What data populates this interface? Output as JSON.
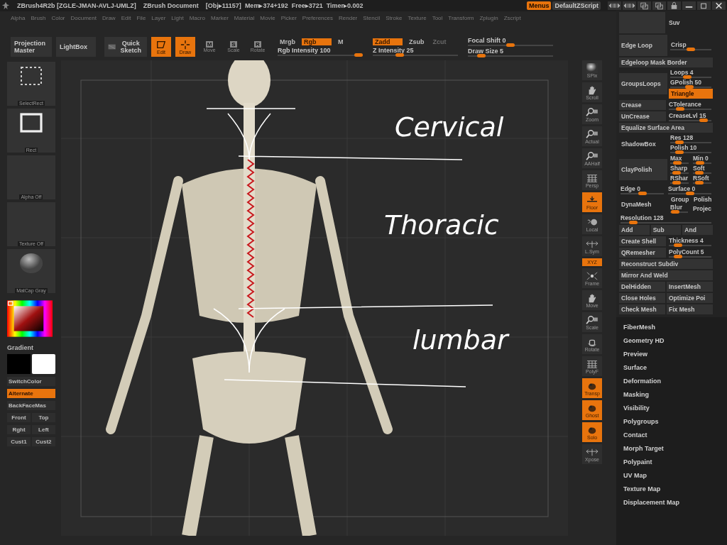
{
  "title_bar": {
    "app": "ZBrush4R2b [ZGLE-JMAN-AVLJ-UMLZ]",
    "document": "ZBrush Document",
    "stats": [
      "[Obj▸11157]",
      "Mem▸374+192",
      "Free▸3721",
      "Timer▸0.002"
    ],
    "buttons": [
      {
        "label": "Menus",
        "selected": true
      },
      {
        "label": "DefaultZScript",
        "selected": false
      }
    ]
  },
  "menu_bar": [
    "Alpha",
    "Brush",
    "Color",
    "Document",
    "Draw",
    "Edit",
    "File",
    "Layer",
    "Light",
    "Macro",
    "Marker",
    "Material",
    "Movie",
    "Picker",
    "Preferences",
    "Render",
    "Stencil",
    "Stroke",
    "Texture",
    "Tool",
    "Transform",
    "Zplugin",
    "Zscript"
  ],
  "toolbar": {
    "buttons": [
      "Projection Master",
      "LightBox",
      "Quick Sketch"
    ],
    "modes": [
      {
        "label": "Edit",
        "on": true
      },
      {
        "label": "Draw",
        "on": true
      },
      {
        "label": "Move",
        "key": "M",
        "on": false
      },
      {
        "label": "Scale",
        "key": "S",
        "on": false
      },
      {
        "label": "Rotate",
        "key": "R",
        "on": false
      }
    ],
    "color_toggles": [
      {
        "label": "Mrgb",
        "on": false
      },
      {
        "label": "Rgb",
        "on": true
      },
      {
        "label": "M",
        "on": false
      }
    ],
    "rgb_intensity": {
      "label": "Rgb Intensity 100",
      "level": 1
    },
    "z_toggles": [
      {
        "label": "Zadd",
        "on": true,
        "disabled": false
      },
      {
        "label": "Zsub",
        "on": false,
        "disabled": false
      },
      {
        "label": "Zcut",
        "on": false,
        "disabled": true
      }
    ],
    "z_intensity": {
      "label": "Z Intensity 25",
      "level": 0.3
    },
    "focal_shift": {
      "label": "Focal Shift 0",
      "level": 0.5
    },
    "draw_size": {
      "label": "Draw Size 5",
      "level": 0.12
    }
  },
  "left_shelf": {
    "thumbnails": [
      {
        "label": "SelectRect",
        "kind": "dashed"
      },
      {
        "label": "Rect",
        "kind": "square"
      },
      {
        "label": "Alpha Off",
        "kind": "empty"
      },
      {
        "label": "Texture Off",
        "kind": "empty"
      },
      {
        "label": "MatCap Gray",
        "kind": "sphere"
      }
    ],
    "gradient": "Gradient",
    "buttons": [
      {
        "label": "SwitchColor",
        "on": false
      },
      {
        "label": "Alternate",
        "on": true
      },
      {
        "label": "BackFaceMas",
        "on": false
      }
    ],
    "view_buttons": [
      [
        "Front",
        "Top"
      ],
      [
        "Rght",
        "Left"
      ],
      [
        "Cust1",
        "Cust2"
      ]
    ]
  },
  "viewport": {
    "annotations": [
      "Cervical",
      "Thoracic",
      "lumbar"
    ]
  },
  "view_tools": [
    {
      "label": "SPix",
      "on": false
    },
    {
      "label": "Scroll",
      "on": false
    },
    {
      "label": "Zoom",
      "on": false
    },
    {
      "label": "Actual",
      "on": false
    },
    {
      "label": "AAHalf",
      "on": false
    },
    {
      "label": "Persp",
      "on": false
    },
    {
      "label": "Floor",
      "on": true
    },
    {
      "label": "Local",
      "on": false
    },
    {
      "label": "L.Sym",
      "on": false
    },
    {
      "label": "XYZ",
      "on": true
    },
    {
      "label": "Frame",
      "on": false
    },
    {
      "label": "Move",
      "on": false
    },
    {
      "label": "Scale",
      "on": false
    },
    {
      "label": "Rotate",
      "on": false
    },
    {
      "label": "PolyF",
      "on": false
    },
    {
      "label": "Transp",
      "on": true
    },
    {
      "label": "Ghost",
      "on": true
    },
    {
      "label": "Solo",
      "on": true
    },
    {
      "label": "Xpose",
      "on": false
    }
  ],
  "tool_panel": {
    "rows": [
      {
        "kind": "row",
        "cells": [
          {
            "kind": "blank"
          },
          {
            "kind": "text",
            "label": "Suv"
          }
        ]
      },
      {
        "kind": "row",
        "cells": [
          {
            "kind": "tall",
            "label": "Edge Loop"
          },
          {
            "kind": "column",
            "cells": [
              {
                "kind": "text",
                "label": "Crisp"
              },
              {
                "kind": "slider",
                "level": 0.5
              }
            ]
          }
        ]
      },
      {
        "kind": "row",
        "cells": [
          {
            "kind": "button",
            "label": "Edgeloop Mask Border"
          }
        ]
      },
      {
        "kind": "row",
        "cells": [
          {
            "kind": "tall",
            "label": "GroupsLoops"
          },
          {
            "kind": "column",
            "cells": [
              {
                "kind": "slider",
                "label": "Loops 4",
                "level": 0.4
              },
              {
                "kind": "slider",
                "label": "GPolish 50",
                "level": 0.45
              },
              {
                "kind": "button",
                "label": "Triangle",
                "selected": true
              }
            ]
          }
        ]
      },
      {
        "kind": "row",
        "cells": [
          {
            "kind": "button",
            "label": "Crease"
          },
          {
            "kind": "slider",
            "label": "CTolerance",
            "level": 0.2
          }
        ]
      },
      {
        "kind": "row",
        "cells": [
          {
            "kind": "button",
            "label": "UnCrease"
          },
          {
            "kind": "slider",
            "label": "CreaseLvl 15",
            "level": 0.9
          }
        ]
      },
      {
        "kind": "row",
        "cells": [
          {
            "kind": "button",
            "label": "Equalize Surface Area"
          }
        ]
      },
      {
        "kind": "row",
        "cells": [
          {
            "kind": "text",
            "label": "ShadowBox"
          },
          {
            "kind": "column",
            "cells": [
              {
                "kind": "slider",
                "label": "Res 128",
                "level": 0.15
              },
              {
                "kind": "slider",
                "label": "Polish 10",
                "level": 0.15
              }
            ]
          }
        ]
      },
      {
        "kind": "row",
        "cells": [
          {
            "kind": "tall",
            "label": "ClayPolish"
          },
          {
            "kind": "column",
            "cells": [
              {
                "kind": "row",
                "cells": [
                  {
                    "kind": "slider",
                    "label": "Max",
                    "level": 0.3
                  },
                  {
                    "kind": "slider",
                    "label": "Min 0",
                    "level": 0.3
                  }
                ]
              },
              {
                "kind": "row",
                "cells": [
                  {
                    "kind": "slider",
                    "label": "Sharp",
                    "level": 0.2
                  },
                  {
                    "kind": "slider",
                    "label": "Soft",
                    "level": 0.2
                  }
                ]
              },
              {
                "kind": "row",
                "cells": [
                  {
                    "kind": "slider",
                    "label": "RShar",
                    "level": 0.2
                  },
                  {
                    "kind": "slider",
                    "label": "RSoft",
                    "level": 0.2
                  }
                ]
              }
            ]
          }
        ]
      },
      {
        "kind": "row",
        "cells": [
          {
            "kind": "slider",
            "label": "Edge 0",
            "level": 0.5
          },
          {
            "kind": "slider",
            "label": "Surface 0",
            "level": 0.5
          }
        ]
      },
      {
        "kind": "row",
        "cells": [
          {
            "kind": "text",
            "label": "DynaMesh"
          },
          {
            "kind": "column",
            "cells": [
              {
                "kind": "row",
                "cells": [
                  {
                    "kind": "text",
                    "label": "Group"
                  },
                  {
                    "kind": "text",
                    "label": "Polish"
                  }
                ]
              },
              {
                "kind": "row",
                "cells": [
                  {
                    "kind": "slider",
                    "label": "Blur",
                    "level": 0.1
                  },
                  {
                    "kind": "text",
                    "label": "Projec"
                  }
                ]
              }
            ]
          }
        ]
      },
      {
        "kind": "row",
        "cells": [
          {
            "kind": "slider",
            "label": "Resolution 128",
            "level": 0.1
          }
        ]
      },
      {
        "kind": "row",
        "cells": [
          {
            "kind": "button",
            "label": "Add"
          },
          {
            "kind": "button",
            "label": "Sub"
          },
          {
            "kind": "button",
            "label": "And"
          }
        ]
      },
      {
        "kind": "row",
        "cells": [
          {
            "kind": "button",
            "label": "Create Shell"
          },
          {
            "kind": "slider",
            "label": "Thickness 4",
            "level": 0.15
          }
        ]
      },
      {
        "kind": "row",
        "cells": [
          {
            "kind": "button",
            "label": "QRemesher"
          },
          {
            "kind": "slider",
            "label": "PolyCount 5",
            "level": 0.15
          }
        ]
      },
      {
        "kind": "row",
        "cells": [
          {
            "kind": "button",
            "label": "Reconstruct Subdiv"
          }
        ]
      },
      {
        "kind": "row",
        "cells": [
          {
            "kind": "button",
            "label": "Mirror And Weld"
          }
        ]
      },
      {
        "kind": "row",
        "cells": [
          {
            "kind": "button",
            "label": "DelHidden"
          },
          {
            "kind": "button",
            "label": "InsertMesh"
          }
        ]
      },
      {
        "kind": "row",
        "cells": [
          {
            "kind": "button",
            "label": "Close Holes"
          },
          {
            "kind": "button",
            "label": "Optimize Poi"
          }
        ]
      },
      {
        "kind": "row",
        "cells": [
          {
            "kind": "button",
            "label": "Check Mesh"
          },
          {
            "kind": "button",
            "label": "Fix Mesh"
          }
        ]
      }
    ],
    "subpalettes": [
      "FiberMesh",
      "Geometry HD",
      "Preview",
      "Surface",
      "Deformation",
      "Masking",
      "Visibility",
      "Polygroups",
      "Contact",
      "Morph Target",
      "Polypaint",
      "UV Map",
      "Texture Map",
      "Displacement Map"
    ]
  }
}
